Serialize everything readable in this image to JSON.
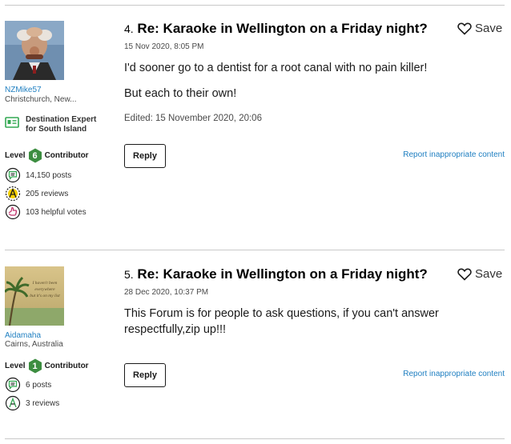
{
  "posts": [
    {
      "number": "4.",
      "title": "Re: Karaoke in Wellington on a Friday night?",
      "date": "15 Nov 2020, 8:05 PM",
      "body": [
        "I'd sooner go to a dentist for a root canal with no pain killer!",
        "But each to their own!"
      ],
      "edited": "Edited: 15 November 2020, 20:06",
      "save_label": "Save",
      "reply_label": "Reply",
      "report_label": "Report inappropriate content",
      "author": {
        "username": "NZMike57",
        "location": "Christchurch, New...",
        "badge_line1": "Destination Expert",
        "badge_line2": "for South Island",
        "level_label": "Level",
        "level_number": "6",
        "level_suffix": "Contributor",
        "posts": "14,150 posts",
        "reviews": "205 reviews",
        "helpful": "103 helpful votes"
      }
    },
    {
      "number": "5.",
      "title": "Re: Karaoke in Wellington on a Friday night?",
      "date": "28 Dec 2020, 10:37 PM",
      "body": [
        "This Forum is for people to ask questions, if you can't answer respectfully,zip up!!!"
      ],
      "save_label": "Save",
      "reply_label": "Reply",
      "report_label": "Report inappropriate content",
      "author": {
        "username": "Aidamaha",
        "location": "Cairns, Australia",
        "level_label": "Level",
        "level_number": "1",
        "level_suffix": "Contributor",
        "posts": "6 posts",
        "reviews": "3 reviews",
        "avatar_text": "I haven't been everywhere but it's on my list"
      }
    }
  ],
  "colors": {
    "accent_green": "#34a853",
    "link_blue": "#1f7fc1",
    "level_green": "#3c8d40"
  }
}
